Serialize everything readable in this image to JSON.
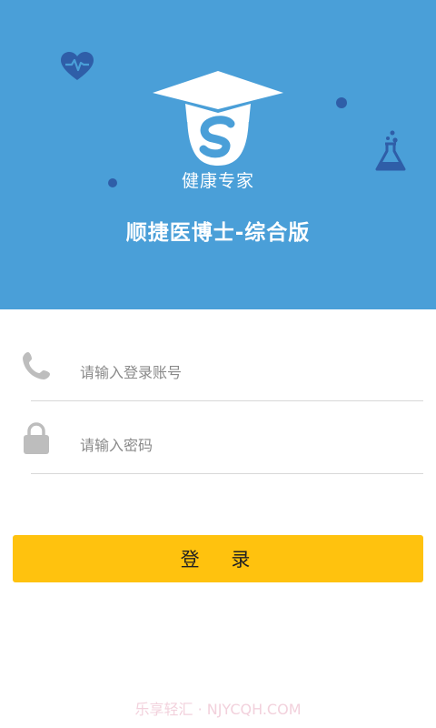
{
  "header": {
    "logo_caption": "健康专家",
    "app_title": "顺捷医博士-综合版"
  },
  "form": {
    "account_placeholder": "请输入登录账号",
    "password_placeholder": "请输入密码",
    "login_label": "登 录"
  },
  "watermark": "乐享轻汇 · NJYCQH.COM",
  "colors": {
    "hero_background": "#4a9fd8",
    "icon_accent": "#2f5ea8",
    "login_button": "#ffc20e",
    "field_icon": "#bdbdbd"
  },
  "icons": {
    "header_left": "heart-pulse-icon",
    "header_right": "flask-icon",
    "account_field": "phone-icon",
    "password_field": "lock-icon"
  }
}
